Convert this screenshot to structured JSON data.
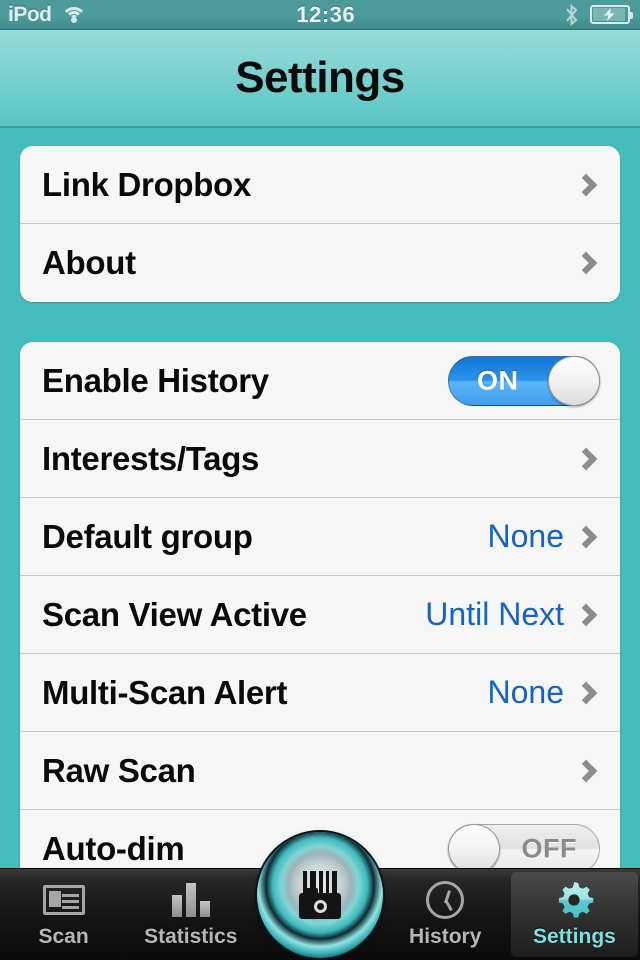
{
  "statusbar": {
    "carrier": "iPod",
    "time": "12:36",
    "wifi_icon": "wifi-icon",
    "bluetooth_icon": "bluetooth-icon",
    "battery_icon": "battery-charging-icon"
  },
  "navbar": {
    "title": "Settings"
  },
  "sections": [
    {
      "rows": [
        {
          "label": "Link Dropbox",
          "accessory": "chevron"
        },
        {
          "label": "About",
          "accessory": "chevron"
        }
      ]
    },
    {
      "rows": [
        {
          "label": "Enable History",
          "accessory": "toggle",
          "toggle_state": "ON"
        },
        {
          "label": "Interests/Tags",
          "accessory": "chevron"
        },
        {
          "label": "Default group",
          "value": "None",
          "accessory": "chevron"
        },
        {
          "label": "Scan View Active",
          "value": "Until Next",
          "accessory": "chevron"
        },
        {
          "label": "Multi-Scan Alert",
          "value": "None",
          "accessory": "chevron"
        },
        {
          "label": "Raw Scan",
          "accessory": "chevron"
        },
        {
          "label": "Auto-dim",
          "accessory": "toggle",
          "toggle_state": "OFF"
        }
      ]
    }
  ],
  "tabbar": {
    "tabs": [
      {
        "label": "Scan",
        "icon": "card-scan-icon",
        "active": false
      },
      {
        "label": "Statistics",
        "icon": "bar-chart-icon",
        "active": false
      },
      {
        "label": "History",
        "icon": "clock-icon",
        "active": false
      },
      {
        "label": "Settings",
        "icon": "gear-icon",
        "active": true
      }
    ],
    "center_button_icon": "barcode-camera-scan-icon"
  },
  "colors": {
    "background_teal": "#45bdbc",
    "navbar_teal": "#7fd3d1",
    "value_blue": "#1663c7",
    "toggle_on_blue": "#2b93ea",
    "active_tab_teal": "#7fdede"
  }
}
